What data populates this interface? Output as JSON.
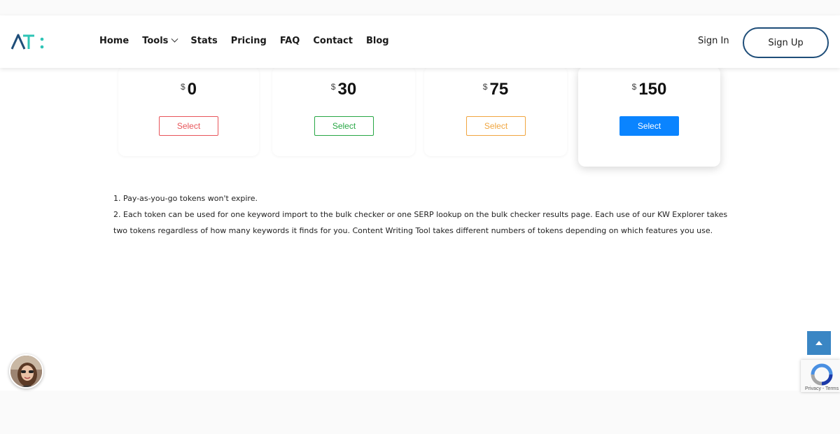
{
  "header": {
    "logo_text": "AT:",
    "nav": [
      {
        "label": "Home",
        "has_dropdown": false
      },
      {
        "label": "Tools",
        "has_dropdown": true
      },
      {
        "label": "Stats",
        "has_dropdown": false
      },
      {
        "label": "Pricing",
        "has_dropdown": false
      },
      {
        "label": "FAQ",
        "has_dropdown": false
      },
      {
        "label": "Contact",
        "has_dropdown": false
      },
      {
        "label": "Blog",
        "has_dropdown": false
      }
    ],
    "sign_in": "Sign In",
    "sign_up": "Sign Up"
  },
  "plans": [
    {
      "currency": "$",
      "price": "0",
      "button": "Select",
      "color": "#e8555a",
      "featured": false
    },
    {
      "currency": "$",
      "price": "30",
      "button": "Select",
      "color": "#28a745",
      "featured": false
    },
    {
      "currency": "$",
      "price": "75",
      "button": "Select",
      "color": "#f0a640",
      "featured": false
    },
    {
      "currency": "$",
      "price": "150",
      "button": "Select",
      "color": "#0a84ff",
      "featured": true
    }
  ],
  "notes": [
    "1. Pay-as-you-go tokens won't expire.",
    "2. Each token can be used for one keyword import to the bulk checker or one SERP lookup on the bulk checker results page. Each use of our KW Explorer takes two tokens regardless of how many keywords it finds for you. Content Writing Tool takes different numbers of tokens depending on which features you use."
  ],
  "widgets": {
    "back_to_top_icon": "caret-up-icon",
    "chat_avatar_icon": "support-agent-avatar",
    "recaptcha_text": "Privacy - Terms"
  },
  "colors": {
    "logo_dark": "#1f4e79",
    "logo_teal": "#2ec4b6",
    "accent": "#0a84ff",
    "signup_border": "#1f4e79"
  }
}
